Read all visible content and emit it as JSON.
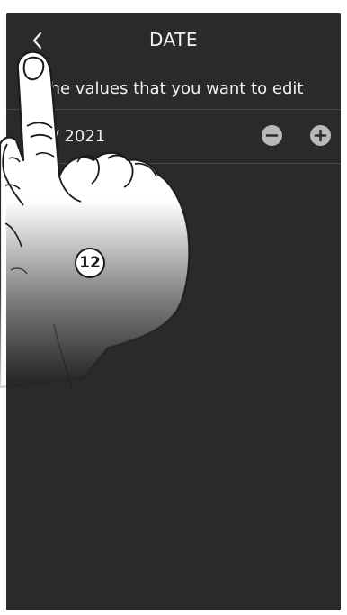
{
  "header": {
    "title": "DATE",
    "back_icon": "chevron-left-icon"
  },
  "instruction": {
    "text": "the values that you want to edit"
  },
  "date_row": {
    "value": "03 / 2021",
    "minus_icon": "minus-icon",
    "plus_icon": "plus-icon"
  },
  "overlay": {
    "step_number": "12",
    "hand_icon": "pointing-hand-icon"
  },
  "colors": {
    "screen_background": "#2b2a2a",
    "text": "#f0f0f0",
    "button": "#b9b9b9",
    "divider": "#4a4949"
  }
}
